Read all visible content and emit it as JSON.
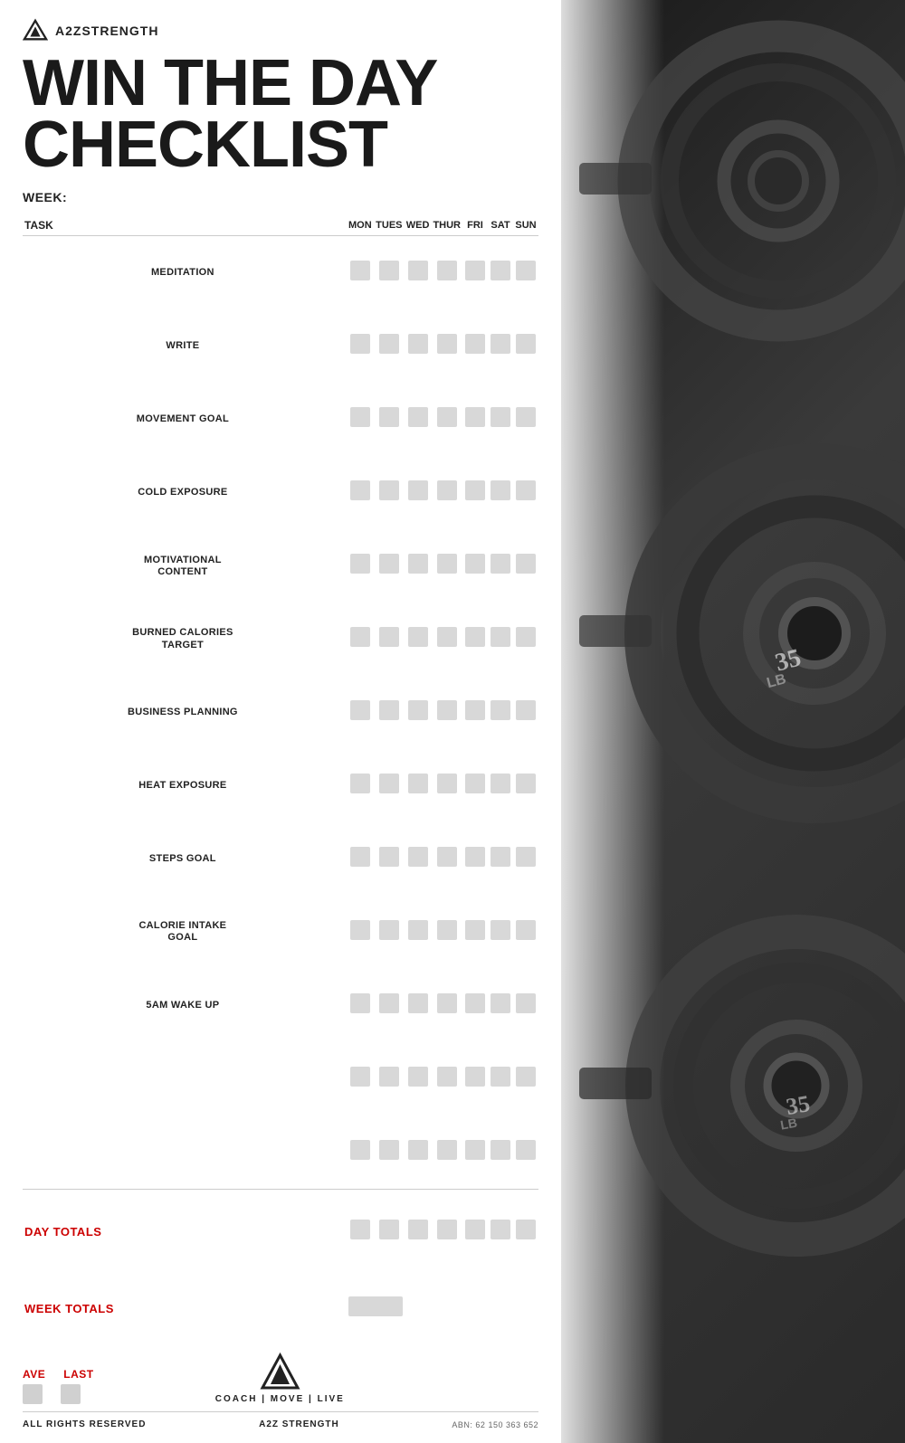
{
  "brand": {
    "logo_text": "A2ZSTRENGTH",
    "logo_icon": "triangle"
  },
  "header": {
    "title_line1": "WIN THE DAY",
    "title_line2": "CHECKLIST",
    "week_label": "WEEK:"
  },
  "table": {
    "columns": {
      "task": "TASK",
      "mon": "MON",
      "tues": "TUES",
      "wed": "WED",
      "thur": "THUR",
      "fri": "FRI",
      "sat": "SAT",
      "sun": "SUN"
    },
    "rows": [
      {
        "name": "MEDITATION"
      },
      {
        "name": "WRITE"
      },
      {
        "name": "MOVEMENT GOAL"
      },
      {
        "name": "COLD EXPOSURE"
      },
      {
        "name": "MOTIVATIONAL\nCONTENT"
      },
      {
        "name": "BURNED CALORIES\nTARGET"
      },
      {
        "name": "BUSINESS PLANNING"
      },
      {
        "name": "HEAT EXPOSURE"
      },
      {
        "name": "STEPS GOAL"
      },
      {
        "name": "CALORIE INTAKE\nGOAL"
      },
      {
        "name": "5am WAKE UP"
      },
      {
        "name": ""
      },
      {
        "name": ""
      }
    ]
  },
  "totals": {
    "day_totals_label": "DAY TOTALS",
    "week_totals_label": "WEEK TOTALS",
    "ave_label": "AVE",
    "last_label": "LAST"
  },
  "footer": {
    "rights": "ALL RIGHTS RESERVED",
    "brand": "A2Z STRENGTH",
    "abn": "ABN: 62 150 363 652",
    "coach_text": "COACH | MOVE | LIVE"
  }
}
